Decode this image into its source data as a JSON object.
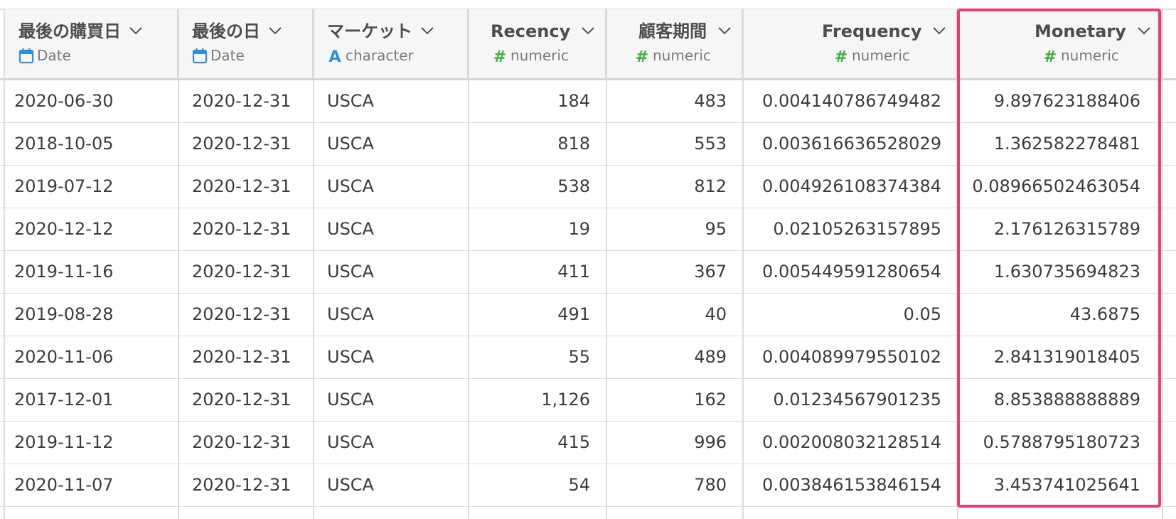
{
  "colors": {
    "accent_highlight": "#ee3a74",
    "date_icon": "#2f8fdf",
    "character_icon": "#2f8fdf",
    "numeric_icon": "#3fae3f"
  },
  "columns": [
    {
      "name": "最後の購買日",
      "type": "Date",
      "type_icon": "calendar-icon",
      "align": "left"
    },
    {
      "name": "最後の日",
      "type": "Date",
      "type_icon": "calendar-icon",
      "align": "left"
    },
    {
      "name": "マーケット",
      "type": "character",
      "type_icon": "character-icon",
      "align": "left"
    },
    {
      "name": "Recency",
      "type": "numeric",
      "type_icon": "hash-icon",
      "align": "right"
    },
    {
      "name": "顧客期間",
      "type": "numeric",
      "type_icon": "hash-icon",
      "align": "right"
    },
    {
      "name": "Frequency",
      "type": "numeric",
      "type_icon": "hash-icon",
      "align": "right"
    },
    {
      "name": "Monetary",
      "type": "numeric",
      "type_icon": "hash-icon",
      "align": "right",
      "highlighted": true
    }
  ],
  "rows": [
    [
      "2020-06-30",
      "2020-12-31",
      "USCA",
      "184",
      "483",
      "0.004140786749482",
      "9.897623188406"
    ],
    [
      "2018-10-05",
      "2020-12-31",
      "USCA",
      "818",
      "553",
      "0.003616636528029",
      "1.362582278481"
    ],
    [
      "2019-07-12",
      "2020-12-31",
      "USCA",
      "538",
      "812",
      "0.004926108374384",
      "0.08966502463054"
    ],
    [
      "2020-12-12",
      "2020-12-31",
      "USCA",
      "19",
      "95",
      "0.02105263157895",
      "2.176126315789"
    ],
    [
      "2019-11-16",
      "2020-12-31",
      "USCA",
      "411",
      "367",
      "0.005449591280654",
      "1.630735694823"
    ],
    [
      "2019-08-28",
      "2020-12-31",
      "USCA",
      "491",
      "40",
      "0.05",
      "43.6875"
    ],
    [
      "2020-11-06",
      "2020-12-31",
      "USCA",
      "55",
      "489",
      "0.004089979550102",
      "2.841319018405"
    ],
    [
      "2017-12-01",
      "2020-12-31",
      "USCA",
      "1,126",
      "162",
      "0.01234567901235",
      "8.853888888889"
    ],
    [
      "2019-11-12",
      "2020-12-31",
      "USCA",
      "415",
      "996",
      "0.002008032128514",
      "0.5788795180723"
    ],
    [
      "2020-11-07",
      "2020-12-31",
      "USCA",
      "54",
      "780",
      "0.003846153846154",
      "3.453741025641"
    ]
  ]
}
